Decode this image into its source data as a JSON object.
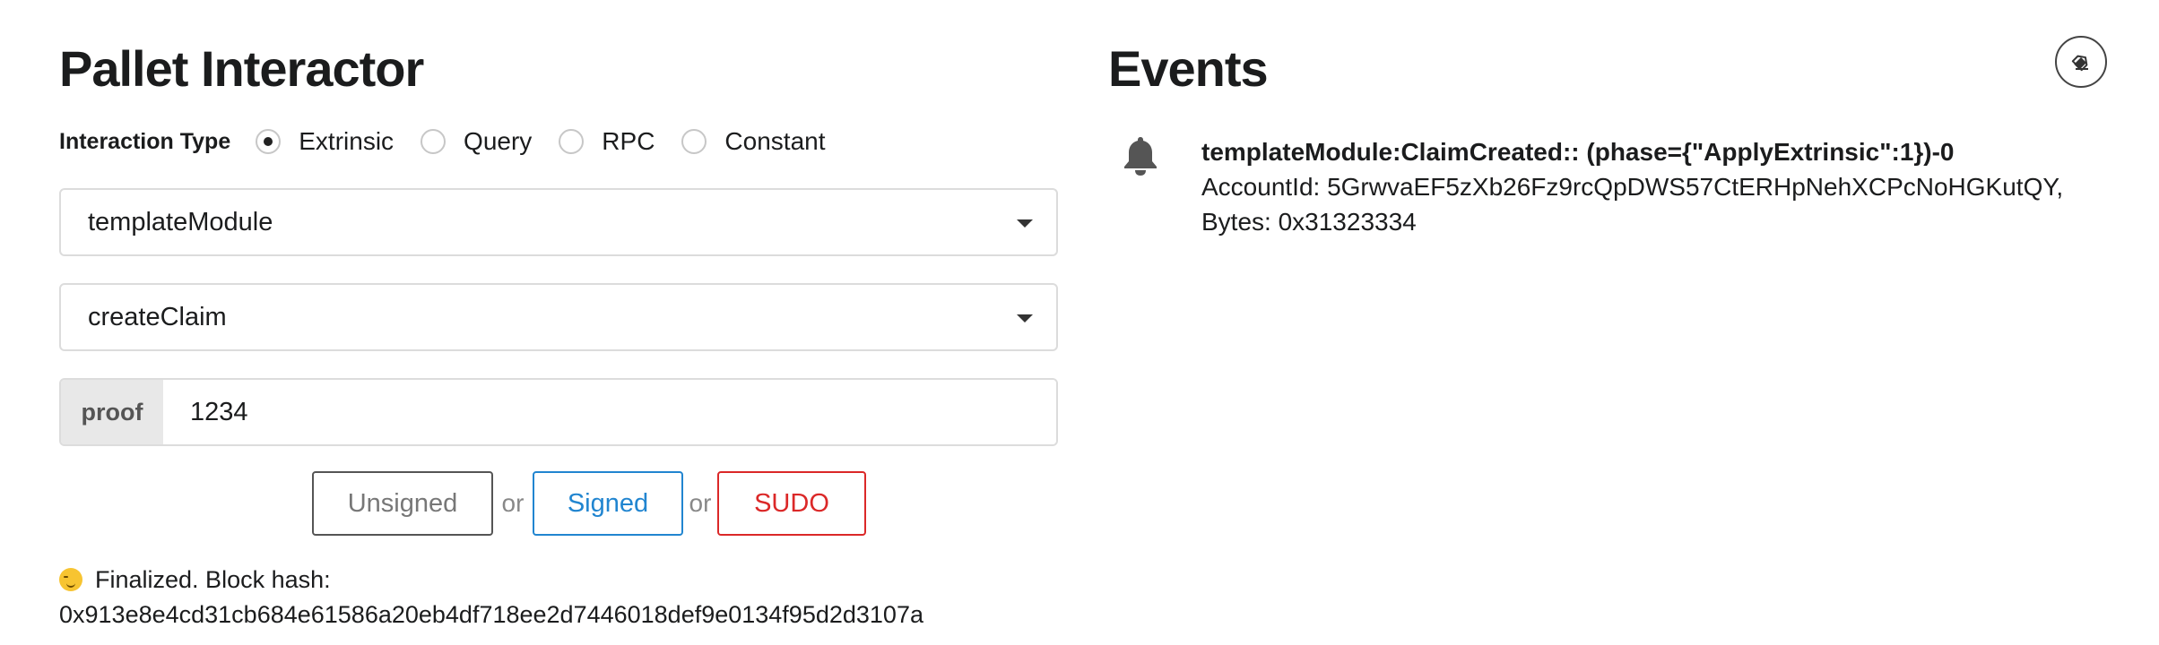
{
  "interactor": {
    "title": "Pallet Interactor",
    "interaction_type_label": "Interaction Type",
    "options": [
      {
        "label": "Extrinsic",
        "selected": true
      },
      {
        "label": "Query",
        "selected": false
      },
      {
        "label": "RPC",
        "selected": false
      },
      {
        "label": "Constant",
        "selected": false
      }
    ],
    "pallet_select": {
      "value": "templateModule"
    },
    "callable_select": {
      "value": "createClaim"
    },
    "param": {
      "label": "proof",
      "value": "1234"
    },
    "buttons": {
      "unsigned": "Unsigned",
      "or": "or",
      "signed": "Signed",
      "sudo": "SUDO"
    },
    "status": {
      "emoji": "winking-face-icon",
      "line1": "Finalized. Block hash:",
      "line2": "0x913e8e4cd31cb684e61586a20eb4df718ee2d7446018def9e0134f95d2d3107a"
    }
  },
  "events": {
    "title": "Events",
    "clear_icon": "eraser-icon",
    "items": [
      {
        "icon": "bell-icon",
        "title": "templateModule:ClaimCreated:: (phase={\"ApplyExtrinsic\":1})-0",
        "body": "AccountId: 5GrwvaEF5zXb26Fz9rcQpDWS57CtERHpNehXCPcNoHGKutQY, Bytes: 0x31323334"
      }
    ]
  }
}
